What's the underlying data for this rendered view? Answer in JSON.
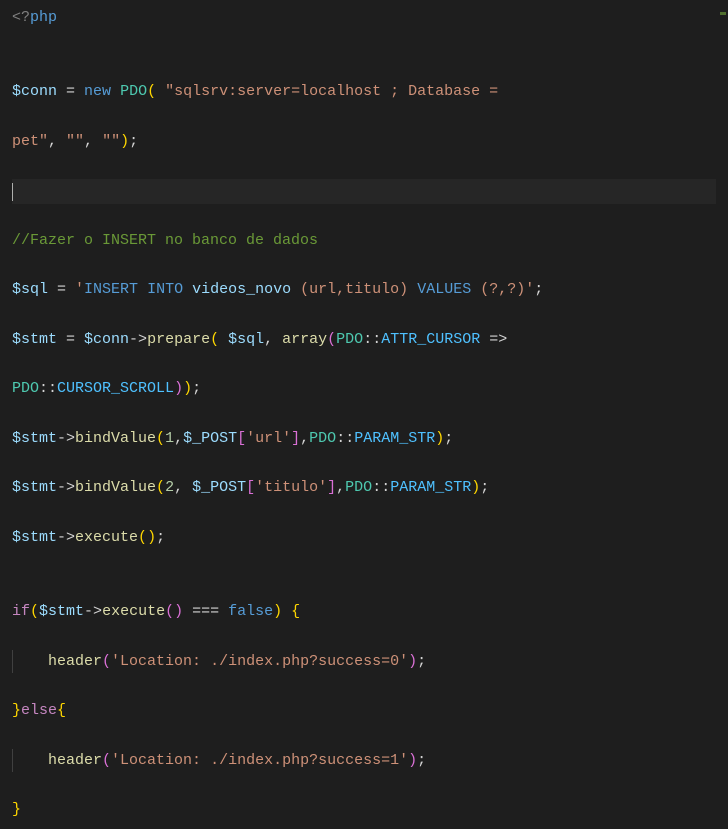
{
  "code": {
    "l1": {
      "open": "<?",
      "php": "php"
    },
    "l3": {
      "var": "$conn",
      "eq": " = ",
      "new": "new",
      "cls": "PDO",
      "p1a": "(",
      "s1": "\"sqlsrv:server=localhost ; Database = ",
      "wrap": "pet\"",
      "c1": ", ",
      "s2": "\"\"",
      "c2": ", ",
      "s3": "\"\"",
      "p1b": ")",
      "semi": ";"
    },
    "l6": {
      "text": "//Fazer o INSERT no banco de dados"
    },
    "l7": {
      "var": "$sql",
      "eq": " = ",
      "s_open": "'",
      "ins": "INSERT",
      "sp1": " ",
      "into": "INTO",
      "sp2": " ",
      "tbl": "videos_novo",
      "sp3": " ",
      "cols": "(url,titulo)",
      "sp4": " ",
      "vals": "VALUES",
      "sp5": " ",
      "ph": "(?,?)",
      "s_close": "'",
      "semi": ";"
    },
    "l8": {
      "var": "$stmt",
      "eq": " = ",
      "conn": "$conn",
      "arrow": "->",
      "fn": "prepare",
      "p1a": "(",
      "sp": " ",
      "sql": "$sql",
      "c": ", ",
      "arr": "array",
      "p2a": "(",
      "pdo": "PDO",
      "dc": "::",
      "attr": "ATTR_CURSOR",
      "fat": " => ",
      "wrap_pdo": "PDO",
      "wrap_dc": "::",
      "wrap_const": "CURSOR_SCROLL",
      "p2b": ")",
      "p1b": ")",
      "semi": ";"
    },
    "l10": {
      "var": "$stmt",
      "arrow": "->",
      "fn": "bindValue",
      "p1a": "(",
      "n": "1",
      "c1": ",",
      "post": "$_POST",
      "b1a": "[",
      "key": "'url'",
      "b1b": "]",
      "c2": ",",
      "pdo": "PDO",
      "dc": "::",
      "const": "PARAM_STR",
      "p1b": ")",
      "semi": ";"
    },
    "l11": {
      "var": "$stmt",
      "arrow": "->",
      "fn": "bindValue",
      "p1a": "(",
      "n": "2",
      "c1": ", ",
      "post": "$_POST",
      "b1a": "[",
      "key": "'titulo'",
      "b1b": "]",
      "c2": ",",
      "pdo": "PDO",
      "dc": "::",
      "const": "PARAM_STR",
      "p1b": ")",
      "semi": ";"
    },
    "l12": {
      "var": "$stmt",
      "arrow": "->",
      "fn": "execute",
      "pa": "(",
      "pb": ")",
      "semi": ";"
    },
    "l14": {
      "if": "if",
      "pa": "(",
      "var": "$stmt",
      "arrow": "->",
      "fn": "execute",
      "p2a": "(",
      "p2b": ")",
      "op": " === ",
      "false": "false",
      "pb": ")",
      "sp": " ",
      "brace": "{"
    },
    "l15": {
      "indent": "    ",
      "fn": "header",
      "pa": "(",
      "s": "'Location: ./index.php?success=0'",
      "pb": ")",
      "semi": ";"
    },
    "l16": {
      "brace1": "}",
      "else": "else",
      "brace2": "{"
    },
    "l17": {
      "indent": "    ",
      "fn": "header",
      "pa": "(",
      "s": "'Location: ./index.php?success=1'",
      "pb": ")",
      "semi": ";"
    },
    "l18": {
      "brace": "}"
    }
  }
}
